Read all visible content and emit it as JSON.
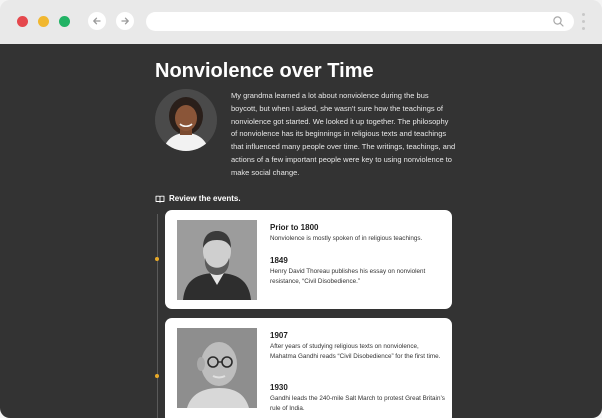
{
  "browser": {
    "window_buttons": [
      {
        "name": "close",
        "color": "#e5484d"
      },
      {
        "name": "minimize",
        "color": "#f1b72f"
      },
      {
        "name": "maximize",
        "color": "#22b365"
      }
    ],
    "back_icon": "arrow-left-icon",
    "forward_icon": "arrow-right-icon",
    "address_value": "",
    "search_icon": "search-icon",
    "menu_icon": "kebab-menu-icon"
  },
  "page": {
    "title": "Nonviolence over Time",
    "intro": "My grandma learned a lot about nonviolence during the bus boycott, but when I asked, she wasn't sure how the teachings of nonviolence got started. We looked it up together. The philosophy of nonviolence has its beginnings in religious texts and teachings that influenced many people over time. The writings, teachings, and actions of a few important people were key to using nonviolence to make social change.",
    "review_label": "Review the events.",
    "accent_color": "#e8a928"
  },
  "timeline": [
    {
      "entries": [
        {
          "year": "Prior to 1800",
          "text": "Nonviolence is mostly spoken of in religious teachings."
        },
        {
          "year": "1849",
          "text": "Henry David Thoreau publishes his essay on nonviolent resistance, “Civil Disobedience.”"
        }
      ]
    },
    {
      "entries": [
        {
          "year": "1907",
          "text": "After years of studying religious texts on nonviolence, Mahatma Gandhi reads “Civil Disobedience” for the first time."
        },
        {
          "year": "1930",
          "text": "Gandhi leads the 240-mile Salt March to protest Great Britain’s rule of India."
        }
      ]
    }
  ]
}
